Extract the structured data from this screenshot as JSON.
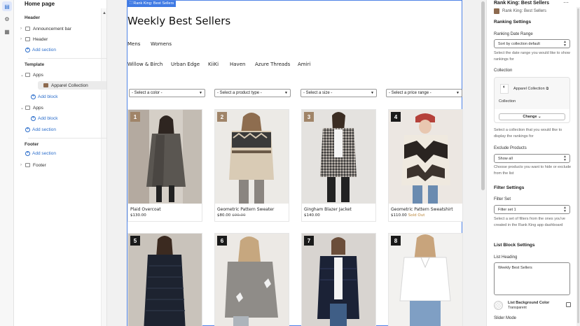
{
  "rail": {
    "icons": [
      "sections-icon",
      "settings-icon",
      "apps-icon"
    ]
  },
  "sidebar": {
    "title": "Home page",
    "header_section": "Header",
    "header_items": [
      "Announcement bar",
      "Header"
    ],
    "add_section": "Add section",
    "template_section": "Template",
    "apps1_label": "Apps",
    "apparel_collection": "Apparel Collection",
    "add_block": "Add block",
    "apps2_label": "Apps",
    "footer_section": "Footer",
    "footer_item": "Footer"
  },
  "preview": {
    "badge": "Rank King: Best Sellers",
    "heading": "Weekly Best Sellers",
    "category_tabs": [
      "Mens",
      "Womens"
    ],
    "brand_tabs": [
      "Willow & Birch",
      "Urban Edge",
      "KiiKi",
      "Haven",
      "Azure Threads",
      "Amiri"
    ],
    "filters": [
      "- Select a color -",
      "- Select a product type -",
      "- Select a size -",
      "- Select a price range -"
    ],
    "products": [
      {
        "rank": "1",
        "name": "Plaid Overcoat",
        "price": "$130.00",
        "compare": "",
        "status": ""
      },
      {
        "rank": "2",
        "name": "Geometric Pattern Sweater",
        "price": "$80.00",
        "compare": "$90.00",
        "status": ""
      },
      {
        "rank": "3",
        "name": "Gingham Blazer Jacket",
        "price": "$140.00",
        "compare": "",
        "status": ""
      },
      {
        "rank": "4",
        "name": "Geometric Pattern Sweatshirt",
        "price": "$110.00",
        "compare": "",
        "status": "Sold Out"
      }
    ],
    "products_row2": [
      {
        "rank": "5"
      },
      {
        "rank": "6"
      },
      {
        "rank": "7"
      },
      {
        "rank": "8"
      }
    ]
  },
  "panel": {
    "title": "Rank King: Best Sellers",
    "subtitle": "Rank King: Best Sellers",
    "ranking_settings": "Ranking Settings",
    "ranking_date_range_label": "Ranking Date Range",
    "ranking_date_range_value": "Sort by collection default",
    "ranking_date_range_help": "Select the date range you would like to show rankings for",
    "collection_label": "Collection",
    "collection_name": "Apparel Collection",
    "collection_sub": "Collection",
    "change_button": "Change",
    "collection_help": "Select a collection that you would like to display the rankings for",
    "exclude_label": "Exclude Products",
    "exclude_value": "Show all",
    "exclude_help": "Choose products you want to hide or exclude from the list",
    "filter_settings": "Filter Settings",
    "filter_set_label": "Filter Set",
    "filter_set_value": "Filter set 1",
    "filter_set_help": "Select a set of filters from the ones you've created in the Rank King app dashboard",
    "list_block_settings": "List Block Settings",
    "list_heading_label": "List Heading",
    "list_heading_value": "Weekly Best Sellers",
    "list_bg_label": "List Background Color",
    "list_bg_value": "Transparent",
    "slider_mode": "Slider Mode"
  },
  "colors": {
    "accent": "#2c6ecb",
    "selection_border": "#4f83e6",
    "rank_dark": "#1a1a1a",
    "rank_tan": "#a08468",
    "sold_out": "#b9863a"
  }
}
